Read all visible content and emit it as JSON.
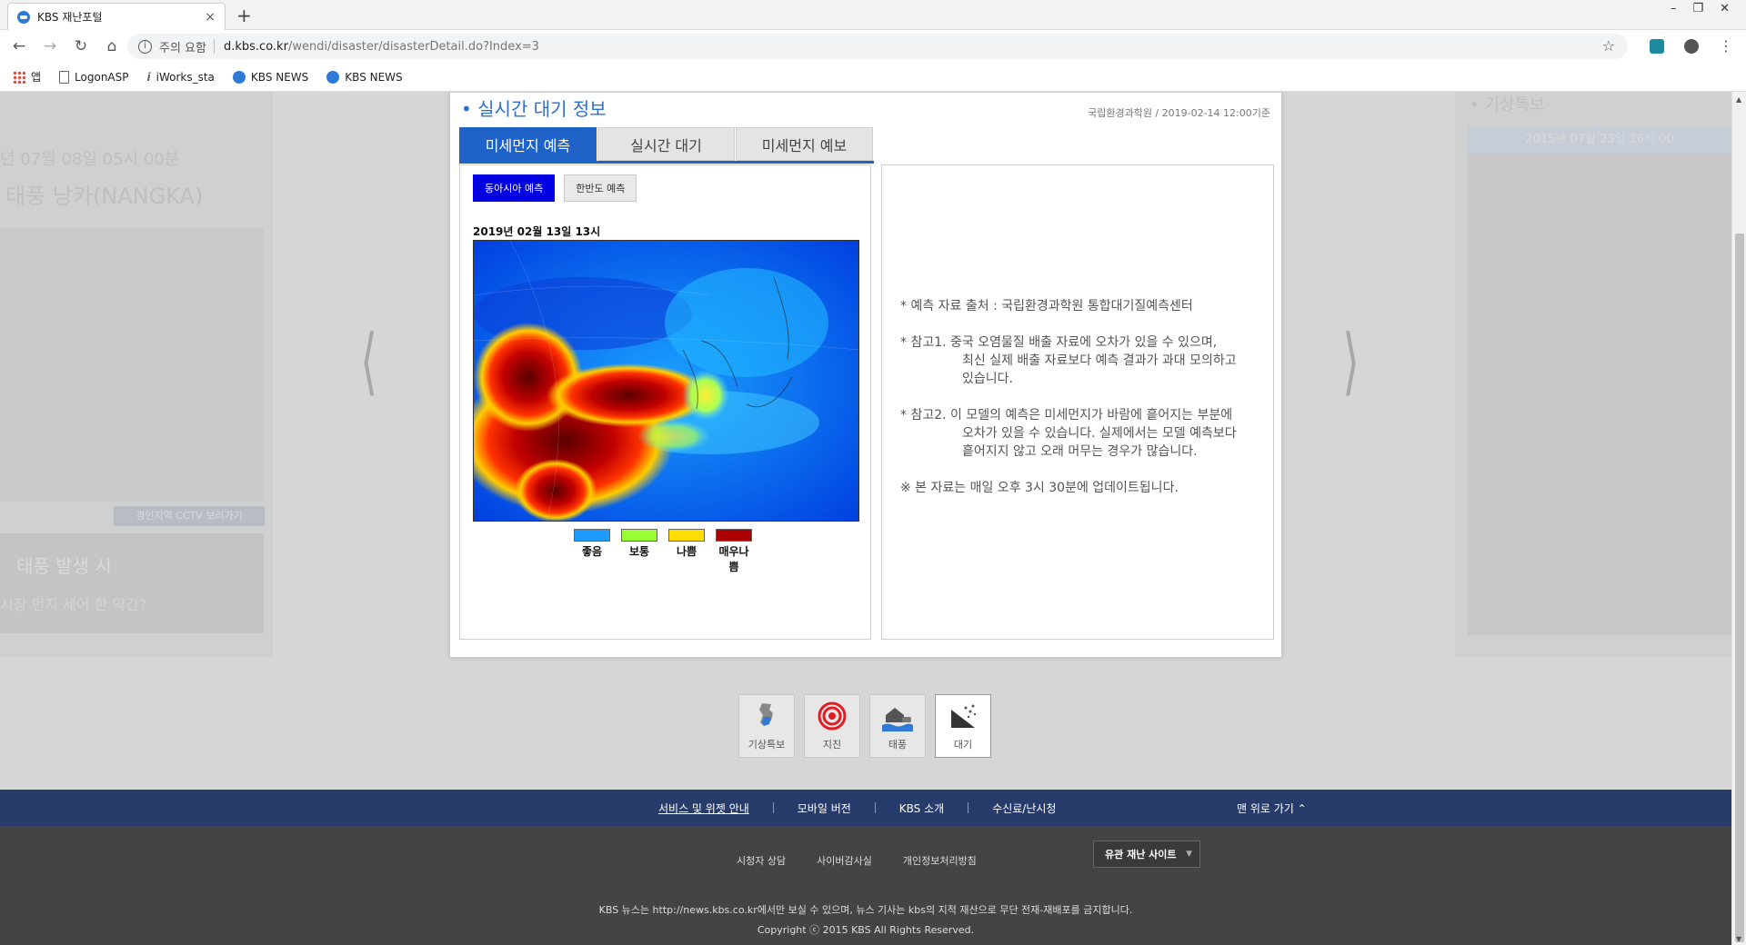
{
  "browser": {
    "tab_title": "KBS 재난포털",
    "new_tab": "+",
    "security_warning": "주의 요함",
    "url_host": "d.kbs.co.kr",
    "url_path": "/wendi/disaster/disasterDetail.do?Index=3",
    "bookmarks": [
      "앱",
      "LogonASP",
      "iWorks_sta",
      "KBS NEWS",
      "KBS NEWS"
    ]
  },
  "background": {
    "left_date": "년 07월 08일 05시 00분",
    "left_name": "태풍 낭카(NANGKA)",
    "left_cctv": "경인지역 CCTV 보러가기",
    "left_promo_1": "태풍 발생 시",
    "left_promo_2": "시장 먼지 세어 한 약간?",
    "right_title": "• 기상특보",
    "right_date": "2015년 07월 23일 16시 00"
  },
  "card": {
    "title": "• 실시간 대기 정보",
    "source": "국립환경과학원 / 2019-02-14 12:00기준",
    "tabs": [
      "미세먼지 예측",
      "실시간 대기",
      "미세먼지 예보"
    ],
    "sub_buttons": [
      "동아시아 예측",
      "한반도 예측"
    ],
    "map_date": "2019년 02월 13일 13시",
    "legend": [
      {
        "label": "좋음",
        "color": "#1e9bff"
      },
      {
        "label": "보통",
        "color": "#99ff33"
      },
      {
        "label": "나쁨",
        "color": "#ffdd00"
      },
      {
        "label": "매우나쁨",
        "color": "#aa0000"
      }
    ],
    "notes": {
      "source": "* 예측 자료 출처 : 국립환경과학원 통합대기질예측센터",
      "ref1_a": "* 참고1. 중국 오염물질 배출 자료에 오차가 있을 수 있으며,",
      "ref1_b": "최신 실제 배출 자료보다 예측 결과가 과대 모의하고",
      "ref1_c": "있습니다.",
      "ref2_a": "* 참고2. 이 모델의 예측은 미세먼지가 바람에 흩어지는 부분에",
      "ref2_b": "오차가 있을 수 있습니다. 실제에서는 모델 예측보다",
      "ref2_c": "흩어지지 않고 오래 머무는 경우가 많습니다.",
      "update": "※ 본 자료는 매일 오후 3시 30분에 업데이트됩니다."
    }
  },
  "categories": [
    "기상특보",
    "지진",
    "태풍",
    "대기"
  ],
  "footer": {
    "nav": [
      "서비스 및 위젯 안내",
      "모바일 버전",
      "KBS 소개",
      "수신료/난시청"
    ],
    "top_link": "맨 위로 가기",
    "links": [
      "시청자 상담",
      "사이버감사실",
      "개인정보처리방침"
    ],
    "related_site": "유관 재난 사이트",
    "notice": "KBS 뉴스는 http://news.kbs.co.kr에서만 보실 수 있으며, 뉴스 기사는 kbs의 지적 재산으로 무단 전재-재배포를 금지합니다.",
    "copyright": "Copyright ⓒ 2015 KBS All Rights Reserved."
  }
}
